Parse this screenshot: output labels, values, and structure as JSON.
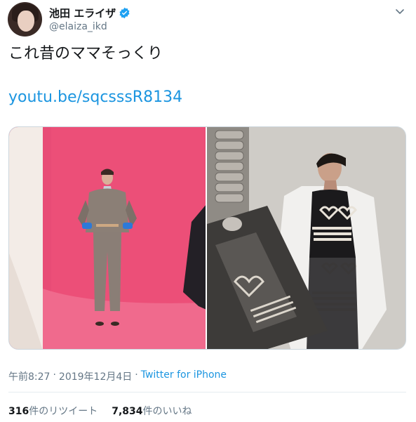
{
  "user": {
    "display_name": "池田 エライザ",
    "handle": "@elaiza_ikd",
    "verified": true
  },
  "tweet": {
    "text": "これ昔のママそっくり",
    "link": "youtu.be/sqcsssR8134"
  },
  "media": {
    "photos": [
      {
        "subject": "fashion-shoot-pink-studio"
      },
      {
        "subject": "magazine-photo-white-coat"
      }
    ]
  },
  "meta": {
    "time": "午前8:27",
    "separator": "·",
    "date": "2019年12月4日",
    "source": "Twitter for iPhone"
  },
  "stats": {
    "retweets_count": "316",
    "retweets_label": "件のリツイート",
    "likes_count": "7,834",
    "likes_label": "件のいいね"
  },
  "colors": {
    "link": "#1b95e0",
    "secondary_text": "#657786",
    "verified": "#1da1f2"
  }
}
